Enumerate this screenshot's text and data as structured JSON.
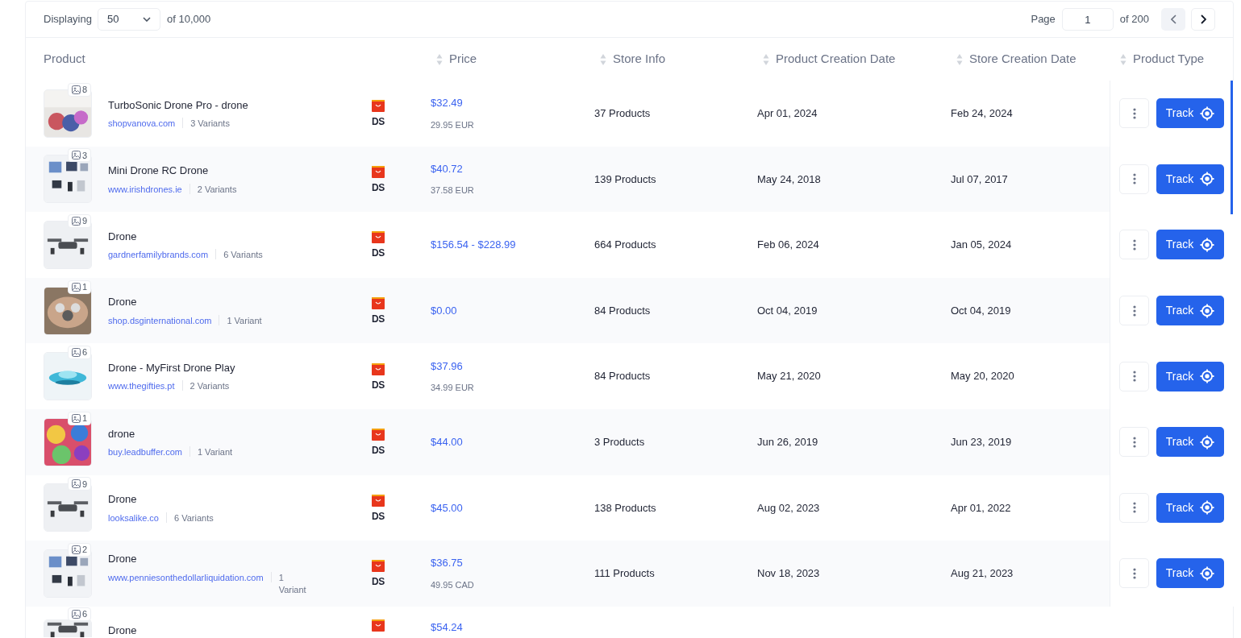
{
  "toolbar": {
    "displaying_label": "Displaying",
    "page_size": "50",
    "total": "of 10,000",
    "page_label": "Page",
    "page": "1",
    "page_total": "of 200"
  },
  "columns": [
    {
      "label": "Product",
      "sortable": false
    },
    {
      "label": "Price",
      "sortable": true
    },
    {
      "label": "Store Info",
      "sortable": true
    },
    {
      "label": "Product Creation Date",
      "sortable": true
    },
    {
      "label": "Store Creation Date",
      "sortable": true
    },
    {
      "label": "Product Type",
      "sortable": true
    }
  ],
  "rows": [
    {
      "image_count": "8",
      "name": "TurboSonic Drone Pro - drone",
      "store": "shopvanova.com",
      "variants": "3 Variants",
      "source": "DS",
      "price": "$32.49",
      "price_sub": "29.95 EUR",
      "store_products": "37 Products",
      "product_created": "Apr 01, 2024",
      "store_created": "Feb 24, 2024",
      "track": "Track"
    },
    {
      "image_count": "3",
      "name": "Mini Drone RC Drone",
      "store": "www.irishdrones.ie",
      "variants": "2 Variants",
      "source": "DS",
      "price": "$40.72",
      "price_sub": "37.58 EUR",
      "store_products": "139 Products",
      "product_created": "May 24, 2018",
      "store_created": "Jul 07, 2017",
      "track": "Track"
    },
    {
      "image_count": "9",
      "name": "Drone",
      "store": "gardnerfamilybrands.com",
      "variants": "6 Variants",
      "source": "DS",
      "price": "$156.54 - $228.99",
      "store_products": "664 Products",
      "product_created": "Feb 06, 2024",
      "store_created": "Jan 05, 2024",
      "track": "Track"
    },
    {
      "image_count": "1",
      "name": "Drone",
      "store": "shop.dsginternational.com",
      "variants": "1 Variant",
      "source": "DS",
      "price": "$0.00",
      "store_products": "84 Products",
      "product_created": "Oct 04, 2019",
      "store_created": "Oct 04, 2019",
      "track": "Track"
    },
    {
      "image_count": "6",
      "name": "Drone - MyFirst Drone Play",
      "store": "www.thegifties.pt",
      "variants": "2 Variants",
      "source": "DS",
      "price": "$37.96",
      "price_sub": "34.99 EUR",
      "store_products": "84 Products",
      "product_created": "May 21, 2020",
      "store_created": "May 20, 2020",
      "track": "Track"
    },
    {
      "image_count": "1",
      "name": "drone",
      "store": "buy.leadbuffer.com",
      "variants": "1 Variant",
      "source": "DS",
      "price": "$44.00",
      "store_products": "3 Products",
      "product_created": "Jun 26, 2019",
      "store_created": "Jun 23, 2019",
      "track": "Track"
    },
    {
      "image_count": "9",
      "name": "Drone",
      "store": "looksalike.co",
      "variants": "6 Variants",
      "source": "DS",
      "price": "$45.00",
      "store_products": "138 Products",
      "product_created": "Aug 02, 2023",
      "store_created": "Apr 01, 2022",
      "track": "Track"
    },
    {
      "image_count": "2",
      "name": "Drone",
      "store": "www.penniesonthedollarliquidation.com",
      "variants": "1 Variant",
      "source": "DS",
      "price": "$36.75",
      "price_sub": "49.95 CAD",
      "store_products": "111 Products",
      "product_created": "Nov 18, 2023",
      "store_created": "Aug 21, 2023",
      "track": "Track"
    },
    {
      "image_count": "6",
      "name": "Drone",
      "price": "$54.24"
    }
  ]
}
